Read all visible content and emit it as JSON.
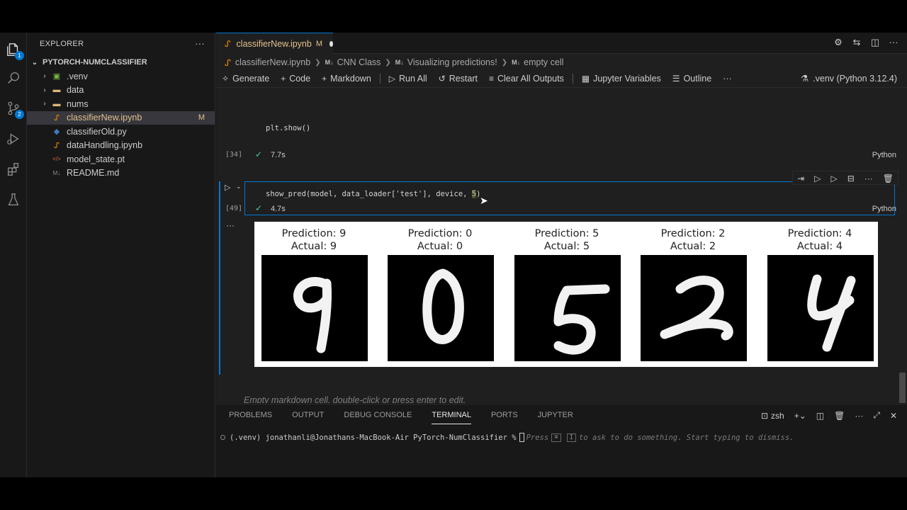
{
  "explorer": {
    "title": "EXPLORER",
    "more_icon": "ellipsis-icon",
    "project": "PYTORCH-NUMCLASSIFIER",
    "items": [
      {
        "label": ".venv",
        "type": "folder",
        "icon": "venv-folder-icon"
      },
      {
        "label": "data",
        "type": "folder",
        "icon": "folder-icon"
      },
      {
        "label": "nums",
        "type": "folder",
        "icon": "folder-icon"
      },
      {
        "label": "classifierNew.ipynb",
        "type": "file",
        "icon": "notebook-icon",
        "badge": "M",
        "active": true
      },
      {
        "label": "classifierOld.py",
        "type": "file",
        "icon": "python-icon"
      },
      {
        "label": "dataHandling.ipynb",
        "type": "file",
        "icon": "notebook-icon"
      },
      {
        "label": "model_state.pt",
        "type": "file",
        "icon": "code-file-icon"
      },
      {
        "label": "README.md",
        "type": "file",
        "icon": "markdown-icon"
      }
    ]
  },
  "activity": {
    "badge_explorer": "1",
    "badge_scm": "2"
  },
  "tab": {
    "label": "classifierNew.ipynb",
    "modified": "M"
  },
  "breadcrumb": {
    "file": "classifierNew.ipynb",
    "parts": [
      "CNN Class",
      "Visualizing predictions!",
      "empty cell"
    ],
    "md_marker": "M↓"
  },
  "toolbar": {
    "generate": "Generate",
    "code": "Code",
    "markdown": "Markdown",
    "run_all": "Run All",
    "restart": "Restart",
    "clear_outputs": "Clear All Outputs",
    "variables": "Jupyter Variables",
    "outline": "Outline",
    "more": "···",
    "kernel": ".venv (Python 3.12.4)"
  },
  "cells": {
    "prev_code": "plt.show()",
    "prev_count": "[34]",
    "prev_time": "7.7s",
    "prev_lang": "Python",
    "cur_code_prefix": "show_pred(model, data_loader['test'], device, ",
    "cur_code_arg": "5",
    "cur_code_suffix": ")",
    "cur_count": "[49]",
    "cur_time": "4.7s",
    "cur_lang": "Python",
    "output_more": "···",
    "md_placeholder": "Empty markdown cell, double-click or press enter to edit."
  },
  "predictions": [
    {
      "prediction": "Prediction: 9",
      "actual": "Actual: 9",
      "digit": "9"
    },
    {
      "prediction": "Prediction: 0",
      "actual": "Actual: 0",
      "digit": "0"
    },
    {
      "prediction": "Prediction: 5",
      "actual": "Actual: 5",
      "digit": "5"
    },
    {
      "prediction": "Prediction: 2",
      "actual": "Actual: 2",
      "digit": "2"
    },
    {
      "prediction": "Prediction: 4",
      "actual": "Actual: 4",
      "digit": "4"
    }
  ],
  "panel": {
    "tabs": [
      "PROBLEMS",
      "OUTPUT",
      "DEBUG CONSOLE",
      "TERMINAL",
      "PORTS",
      "JUPYTER"
    ],
    "active_tab": "TERMINAL",
    "shell": "zsh",
    "prompt": "(.venv) jonathanli@Jonathans-MacBook-Air PyTorch-NumClassifier % ",
    "hint_pre": "Press",
    "hint_key1": "⌘",
    "hint_key2": "I",
    "hint_post": "to ask to do something. Start typing to dismiss."
  },
  "colors": {
    "accent": "#0078d4",
    "modified": "#e2c08d",
    "success": "#4ec9b0"
  }
}
